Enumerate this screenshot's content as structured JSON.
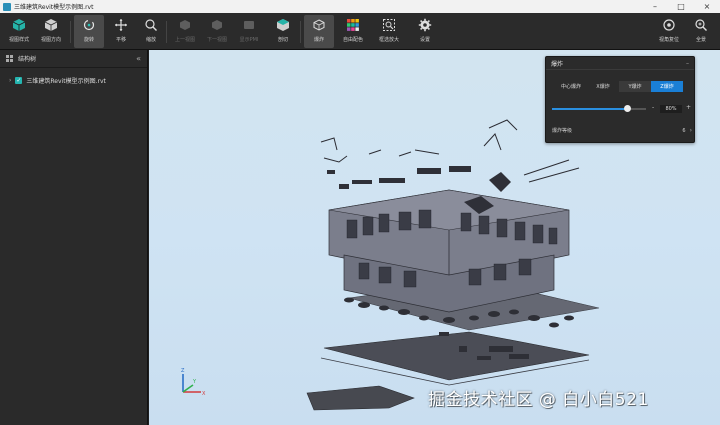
{
  "window": {
    "title": "三维建筑Revit模型示例图.rvt"
  },
  "toolbar": {
    "view_style": "视图样式",
    "view_direction": "视图方向",
    "rotate": "旋转",
    "pan": "平移",
    "zoom": "缩放",
    "prev_view": "上一视图",
    "next_view": "下一视图",
    "show_pmi": "显示PMI",
    "section": "剖切",
    "explode": "爆炸",
    "custom_color": "自由配色",
    "frame_zoom": "框选放大",
    "settings": "设置",
    "view_position": "视角复位",
    "full_view": "全景"
  },
  "sidebar": {
    "title": "结构树",
    "tree": [
      {
        "label": "三维建筑Revit模型示例图.rvt",
        "checked": true
      }
    ]
  },
  "explode_panel": {
    "title": "爆炸",
    "modes": [
      "中心爆炸",
      "X爆炸",
      "Y爆炸",
      "Z爆炸"
    ],
    "selected_mode": "Z爆炸",
    "slider_value": 0.8,
    "slider_label": "80%",
    "level_label": "爆炸等级",
    "level_value": "6"
  },
  "axes": {
    "x": "X",
    "y": "Y",
    "z": "Z"
  },
  "watermark": "掘金技术社区 @ 白小白521",
  "colors": {
    "accent": "#1a7fd6",
    "toolbar_bg": "#2b2b2b",
    "check": "#24b5b0"
  }
}
